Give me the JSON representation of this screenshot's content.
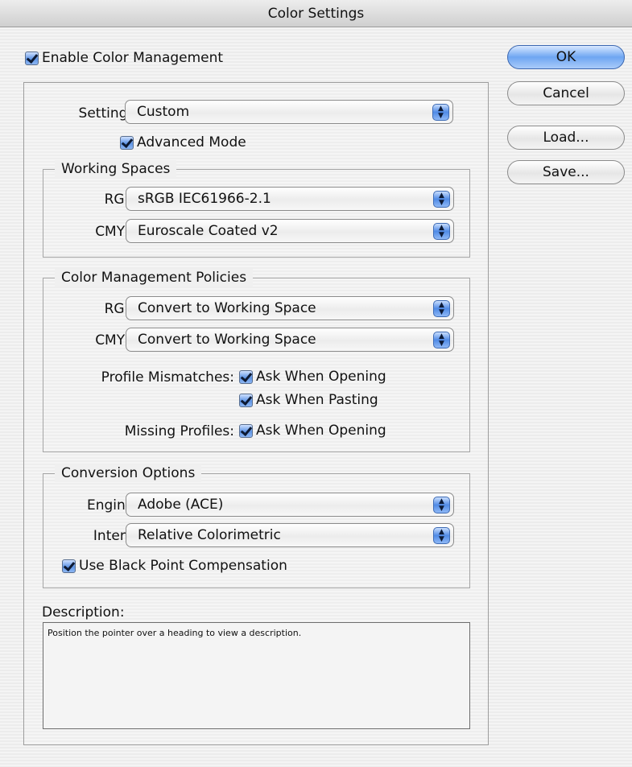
{
  "window": {
    "title": "Color Settings"
  },
  "enable_color_management": {
    "label": "Enable Color Management",
    "checked": true
  },
  "buttons": {
    "ok": "OK",
    "cancel": "Cancel",
    "load": "Load...",
    "save": "Save..."
  },
  "settings": {
    "label": "Settings:",
    "value": "Custom",
    "advanced_mode": {
      "label": "Advanced Mode",
      "checked": true
    }
  },
  "working_spaces": {
    "title": "Working Spaces",
    "rgb": {
      "label": "RGB:",
      "value": "sRGB IEC61966-2.1"
    },
    "cmyk": {
      "label": "CMYK:",
      "value": "Euroscale Coated v2"
    }
  },
  "policies": {
    "title": "Color Management Policies",
    "rgb": {
      "label": "RGB:",
      "value": "Convert to Working Space"
    },
    "cmyk": {
      "label": "CMYK:",
      "value": "Convert to Working Space"
    },
    "profile_mismatches": {
      "label": "Profile Mismatches:",
      "ask_opening": {
        "label": "Ask When Opening",
        "checked": true
      },
      "ask_pasting": {
        "label": "Ask When Pasting",
        "checked": true
      }
    },
    "missing_profiles": {
      "label": "Missing Profiles:",
      "ask_opening": {
        "label": "Ask When Opening",
        "checked": true
      }
    }
  },
  "conversion": {
    "title": "Conversion Options",
    "engine": {
      "label": "Engine:",
      "value": "Adobe (ACE)"
    },
    "intent": {
      "label": "Intent:",
      "value": "Relative Colorimetric"
    },
    "black_point": {
      "label": "Use Black Point Compensation",
      "checked": true
    }
  },
  "description": {
    "label": "Description:",
    "text": "Position the pointer over a heading to view a description."
  },
  "icons": {
    "checkbox": "checkmark-icon",
    "popup": "up-down-arrows-icon"
  },
  "colors": {
    "accent_blue": "#6ea6f2",
    "checkbox_blue": "#5f95e6"
  }
}
